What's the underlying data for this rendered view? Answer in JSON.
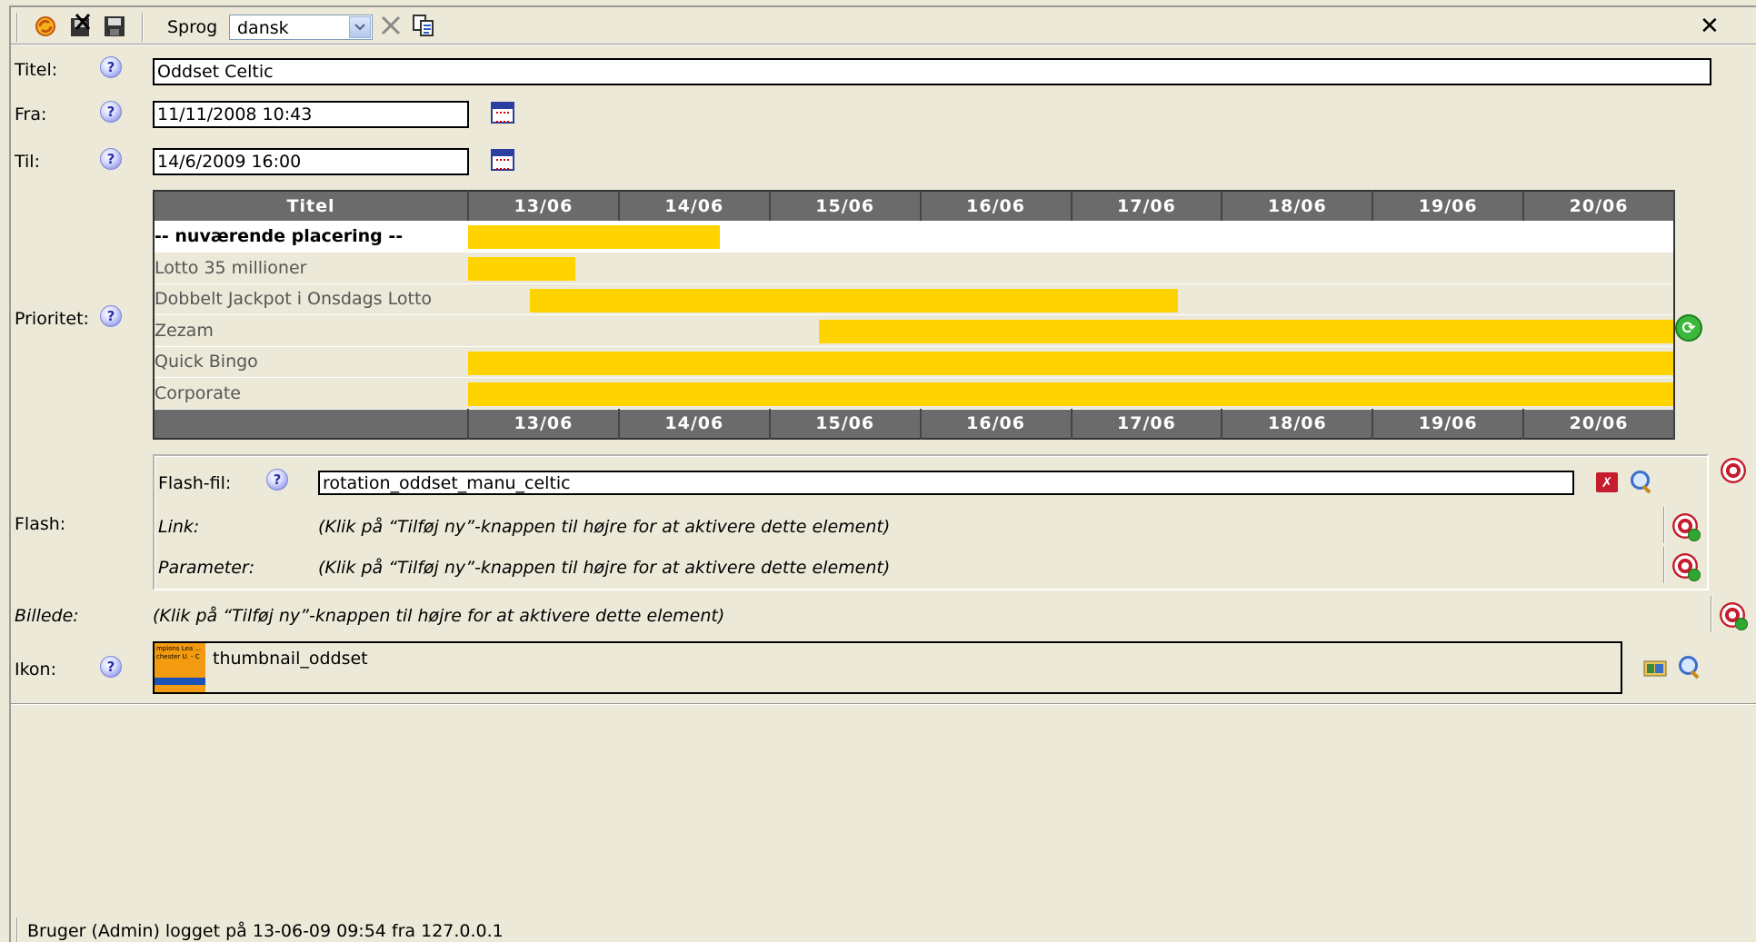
{
  "toolbar": {
    "language_label": "Sprog",
    "language_value": "dansk",
    "close_glyph": "✕",
    "icons": [
      "refresh-icon",
      "delete-icon",
      "save-icon",
      "clear-icon",
      "copy-icon"
    ]
  },
  "form": {
    "title_label": "Titel:",
    "title_value": "Oddset Celtic",
    "from_label": "Fra:",
    "from_value": "11/11/2008 10:43",
    "to_label": "Til:",
    "to_value": "14/6/2009 16:00",
    "priority_label": "Prioritet:",
    "flash_label": "Flash:",
    "image_label": "Billede:",
    "image_hint": "(Klik på “Tilføj ny”-knappen til højre for at aktivere dette element)",
    "icon_label": "Ikon:",
    "icon_value": "thumbnail_oddset",
    "icon_thumb_text": "mpions Lea ... chester U. - C"
  },
  "help_glyph": "?",
  "schedule": {
    "title_header": "Titel",
    "dates": [
      "13/06",
      "14/06",
      "15/06",
      "16/06",
      "17/06",
      "18/06",
      "19/06",
      "20/06"
    ],
    "rows": [
      {
        "title": "-- nuværende placering --",
        "current": true,
        "start": 0.0,
        "end": 1.67
      },
      {
        "title": "Lotto 35 millioner",
        "current": false,
        "start": 0.0,
        "end": 0.71
      },
      {
        "title": "Dobbelt Jackpot i Onsdags Lotto",
        "current": false,
        "start": 0.41,
        "end": 4.71
      },
      {
        "title": "Zezam",
        "current": false,
        "start": 2.33,
        "end": 8.0
      },
      {
        "title": "Quick Bingo",
        "current": false,
        "start": 0.0,
        "end": 8.0
      },
      {
        "title": "Corporate",
        "current": false,
        "start": 0.0,
        "end": 8.0
      }
    ],
    "bar_color": "#ffd300"
  },
  "flash": {
    "file_label": "Flash-fil:",
    "file_value": "rotation_oddset_manu_celtic",
    "link_label": "Link:",
    "link_hint": "(Klik på “Tilføj ny”-knappen til højre for at aktivere dette element)",
    "param_label": "Parameter:",
    "param_hint": "(Klik på “Tilføj ny”-knappen til højre for at aktivere dette element)"
  },
  "status": {
    "text": "Bruger (Admin) logget på 13-06-09 09:54 fra 127.0.0.1"
  }
}
